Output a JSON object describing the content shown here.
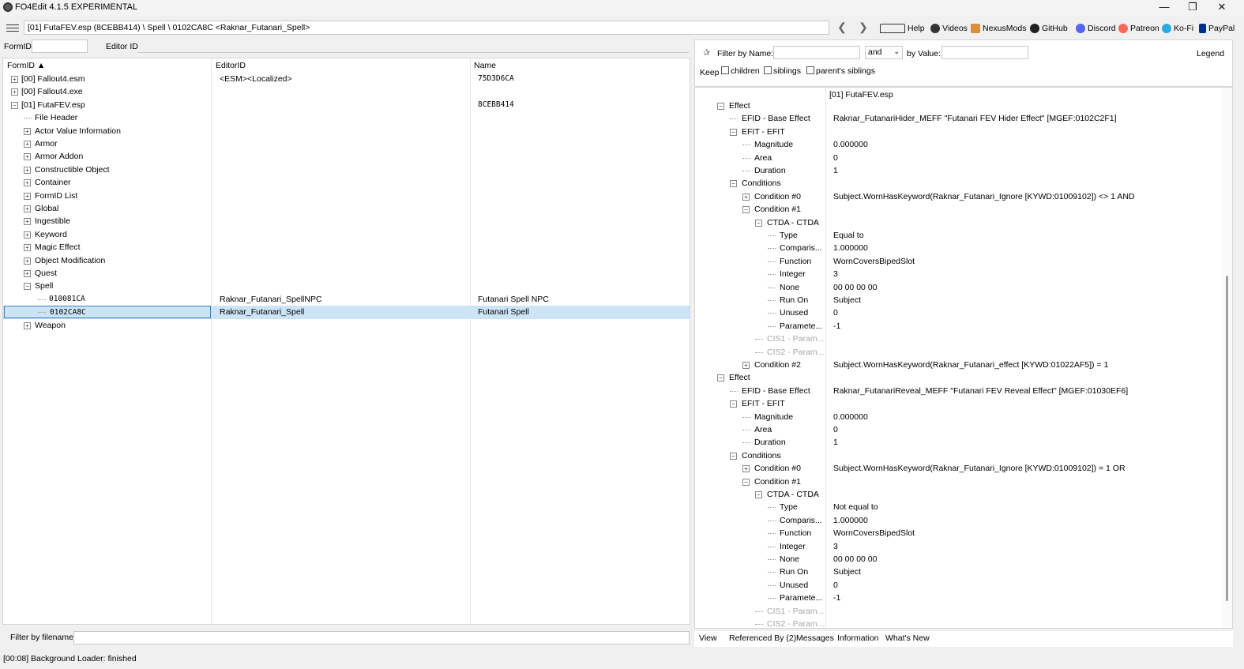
{
  "window": {
    "title": "FO4Edit 4.1.5 EXPERIMENTAL",
    "controls": [
      "—",
      "❐",
      "✕"
    ]
  },
  "toolbar": {
    "path": "[01] FutaFEV.esp (8CEBB414) \\ Spell \\ 0102CA8C <Raknar_Futanari_Spell>",
    "back": "❮",
    "forward": "❯",
    "links": [
      "Help",
      "Videos",
      "NexusMods",
      "GitHub",
      "Discord",
      "Patreon",
      "Ko-Fi",
      "PayPal"
    ]
  },
  "left_filter": {
    "formid_label": "FormID",
    "formid_value": "",
    "editorid_label": "Editor ID",
    "editorid_value": ""
  },
  "tree": {
    "columns": [
      "FormID ▲",
      "EditorID",
      "Name"
    ],
    "rows": [
      {
        "exp": "+",
        "c1": "[00] Fallout4.esm",
        "c2": "<ESM><Localized>",
        "c3": "75D3D6CA"
      },
      {
        "exp": "+",
        "c1": "[00] Fallout4.exe",
        "c2": "",
        "c3": ""
      },
      {
        "exp": "−",
        "c1": "[01] FutaFEV.esp",
        "c2": "",
        "c3": "8CEBB414"
      },
      {
        "exp": "",
        "c1": "File Header",
        "c2": "",
        "c3": ""
      },
      {
        "exp": "+",
        "c1": "Actor Value Information",
        "c2": "",
        "c3": ""
      },
      {
        "exp": "+",
        "c1": "Armor",
        "c2": "",
        "c3": ""
      },
      {
        "exp": "+",
        "c1": "Armor Addon",
        "c2": "",
        "c3": ""
      },
      {
        "exp": "+",
        "c1": "Constructible Object",
        "c2": "",
        "c3": ""
      },
      {
        "exp": "+",
        "c1": "Container",
        "c2": "",
        "c3": ""
      },
      {
        "exp": "+",
        "c1": "FormID List",
        "c2": "",
        "c3": ""
      },
      {
        "exp": "+",
        "c1": "Global",
        "c2": "",
        "c3": ""
      },
      {
        "exp": "+",
        "c1": "Ingestible",
        "c2": "",
        "c3": ""
      },
      {
        "exp": "+",
        "c1": "Keyword",
        "c2": "",
        "c3": ""
      },
      {
        "exp": "+",
        "c1": "Magic Effect",
        "c2": "",
        "c3": ""
      },
      {
        "exp": "+",
        "c1": "Object Modification",
        "c2": "",
        "c3": ""
      },
      {
        "exp": "+",
        "c1": "Quest",
        "c2": "",
        "c3": ""
      },
      {
        "exp": "−",
        "c1": "Spell",
        "c2": "",
        "c3": ""
      },
      {
        "exp": "",
        "c1": "010081CA",
        "c2": "Raknar_Futanari_SpellNPC",
        "c3": "Futanari Spell NPC"
      },
      {
        "exp": "",
        "c1": "0102CA8C",
        "c2": "Raknar_Futanari_Spell",
        "c3": "Futanari Spell"
      },
      {
        "exp": "+",
        "c1": "Weapon",
        "c2": "",
        "c3": ""
      }
    ]
  },
  "left_bottom": {
    "label": "Filter by filename:",
    "value": ""
  },
  "right_filter": {
    "pin": "✰",
    "name_label": "Filter by Name:",
    "name_value": "",
    "op_value": "and",
    "value_label": "by Value:",
    "value_value": "",
    "legend": "Legend",
    "keep_label": "Keep",
    "keep_options": [
      "children",
      "siblings",
      "parent's siblings"
    ]
  },
  "record": {
    "header": "[01] FutaFEV.esp",
    "rows": [
      {
        "exp": "−",
        "name": "Effect",
        "value": ""
      },
      {
        "exp": "",
        "name": "EFID - Base Effect",
        "value": "Raknar_FutanariHider_MEFF \"Futanari FEV Hider Effect\" [MGEF:0102C2F1]"
      },
      {
        "exp": "−",
        "name": "EFIT - EFIT",
        "value": ""
      },
      {
        "exp": "",
        "name": "Magnitude",
        "value": "0.000000"
      },
      {
        "exp": "",
        "name": "Area",
        "value": "0"
      },
      {
        "exp": "",
        "name": "Duration",
        "value": "1"
      },
      {
        "exp": "−",
        "name": "Conditions",
        "value": ""
      },
      {
        "exp": "+",
        "name": "Condition #0",
        "value": "Subject.WornHasKeyword(Raknar_Futanari_Ignore [KYWD:01009102]) <> 1 AND"
      },
      {
        "exp": "−",
        "name": "Condition #1",
        "value": ""
      },
      {
        "exp": "−",
        "name": "CTDA - CTDA",
        "value": ""
      },
      {
        "exp": "",
        "name": "Type",
        "value": "Equal to"
      },
      {
        "exp": "",
        "name": "Comparis...",
        "value": "1.000000"
      },
      {
        "exp": "",
        "name": "Function",
        "value": "WornCoversBipedSlot"
      },
      {
        "exp": "",
        "name": "Integer",
        "value": "3"
      },
      {
        "exp": "",
        "name": "None",
        "value": "00 00 00 00"
      },
      {
        "exp": "",
        "name": "Run On",
        "value": "Subject"
      },
      {
        "exp": "",
        "name": "Unused",
        "value": "0"
      },
      {
        "exp": "",
        "name": "Paramete...",
        "value": "-1"
      },
      {
        "exp": "",
        "name": "CIS1 - Param...",
        "value": ""
      },
      {
        "exp": "",
        "name": "CIS2 - Param...",
        "value": ""
      },
      {
        "exp": "+",
        "name": "Condition #2",
        "value": "Subject.WornHasKeyword(Raknar_Futanari_effect [KYWD:01022AF5]) = 1"
      },
      {
        "exp": "−",
        "name": "Effect",
        "value": ""
      },
      {
        "exp": "",
        "name": "EFID - Base Effect",
        "value": "Raknar_FutanariReveal_MEFF \"Futanari FEV Reveal Effect\" [MGEF:01030EF6]"
      },
      {
        "exp": "−",
        "name": "EFIT - EFIT",
        "value": ""
      },
      {
        "exp": "",
        "name": "Magnitude",
        "value": "0.000000"
      },
      {
        "exp": "",
        "name": "Area",
        "value": "0"
      },
      {
        "exp": "",
        "name": "Duration",
        "value": "1"
      },
      {
        "exp": "−",
        "name": "Conditions",
        "value": ""
      },
      {
        "exp": "+",
        "name": "Condition #0",
        "value": "Subject.WornHasKeyword(Raknar_Futanari_Ignore [KYWD:01009102]) = 1 OR"
      },
      {
        "exp": "−",
        "name": "Condition #1",
        "value": ""
      },
      {
        "exp": "−",
        "name": "CTDA - CTDA",
        "value": ""
      },
      {
        "exp": "",
        "name": "Type",
        "value": "Not equal to"
      },
      {
        "exp": "",
        "name": "Comparis...",
        "value": "1.000000"
      },
      {
        "exp": "",
        "name": "Function",
        "value": "WornCoversBipedSlot"
      },
      {
        "exp": "",
        "name": "Integer",
        "value": "3"
      },
      {
        "exp": "",
        "name": "None",
        "value": "00 00 00 00"
      },
      {
        "exp": "",
        "name": "Run On",
        "value": "Subject"
      },
      {
        "exp": "",
        "name": "Unused",
        "value": "0"
      },
      {
        "exp": "",
        "name": "Paramete...",
        "value": "-1"
      },
      {
        "exp": "",
        "name": "CIS1 - Param...",
        "value": ""
      },
      {
        "exp": "",
        "name": "CIS2 - Param...",
        "value": ""
      }
    ]
  },
  "tabs": [
    "View",
    "Referenced By (2)",
    "Messages",
    "Information",
    "What's New"
  ],
  "status": "[00:08] Background Loader: finished"
}
